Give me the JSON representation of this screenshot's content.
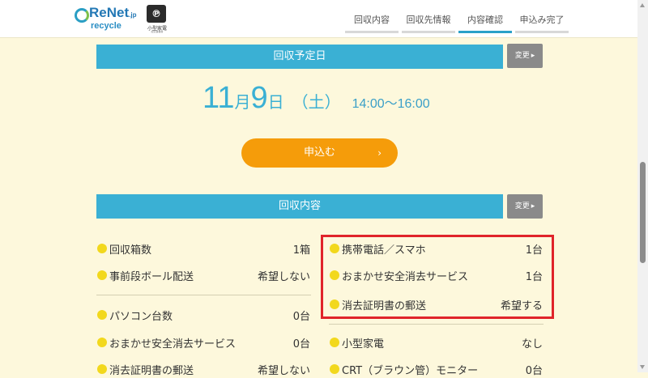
{
  "header": {
    "logo_main": "ReNet",
    "logo_jp": ".jp",
    "logo_sub": "recycle",
    "badge_text": "小型家電",
    "badge_sub": "認定事業者",
    "steps": [
      {
        "label": "回収内容",
        "active": false
      },
      {
        "label": "回収先情報",
        "active": false
      },
      {
        "label": "内容確認",
        "active": true
      },
      {
        "label": "申込み完了",
        "active": false
      }
    ]
  },
  "schedule": {
    "title": "回収予定日",
    "edit_label": "変更",
    "month": "11",
    "month_unit": "月",
    "day": "9",
    "day_unit": "日",
    "weekday": "（土）",
    "time": "14:00〜16:00"
  },
  "apply_button": {
    "label": "申込む",
    "chevron": "›"
  },
  "contents": {
    "title": "回収内容",
    "edit_label": "変更",
    "left_items": [
      {
        "label": "回収箱数",
        "value": "1箱"
      },
      {
        "label": "事前段ボール配送",
        "value": "希望しない"
      },
      {
        "label": "パソコン台数",
        "value": "0台"
      },
      {
        "label": "おまかせ安全消去サービス",
        "value": "0台"
      },
      {
        "label": "消去証明書の郵送",
        "value": "希望しない"
      }
    ],
    "right_items": [
      {
        "label": "携帯電話／スマホ",
        "value": "1台"
      },
      {
        "label": "おまかせ安全消去サービス",
        "value": "1台"
      },
      {
        "label": "消去証明書の郵送",
        "value": "希望する"
      },
      {
        "label": "小型家電",
        "value": "なし"
      },
      {
        "label": "CRT（ブラウン管）モニター",
        "value": "0台"
      }
    ]
  },
  "colors": {
    "accent": "#3ab0d4",
    "button": "#f59c0a",
    "highlight": "#e0242a",
    "bullet": "#f2d81d",
    "background": "#fdf8dc"
  }
}
